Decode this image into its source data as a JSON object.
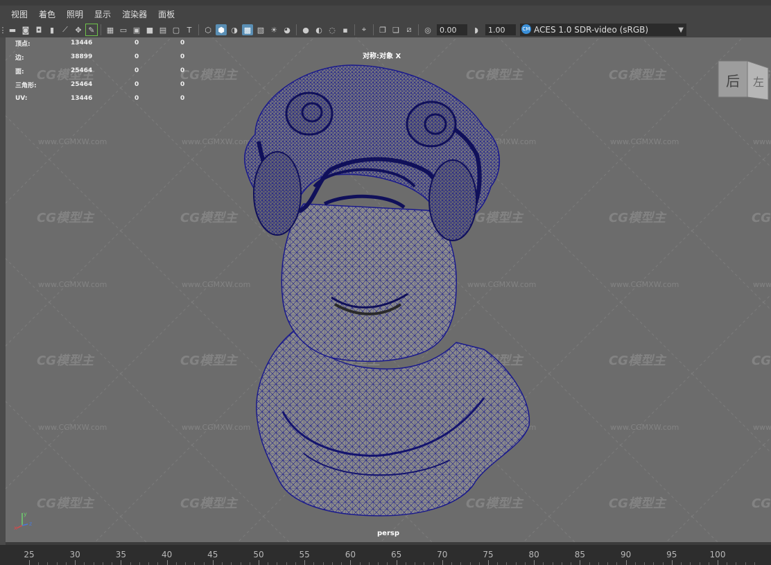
{
  "menu": [
    "视图",
    "着色",
    "照明",
    "显示",
    "渲染器",
    "面板"
  ],
  "toolbar": {
    "field1": "0.00",
    "field2": "1.00",
    "color_management": "ACES 1.0 SDR-video (sRGB)",
    "cm_icon_label": "CM",
    "dropdown_arrow": "▼"
  },
  "stats": [
    {
      "label": "顶点:",
      "v1": "13446",
      "v2": "0",
      "v3": "0"
    },
    {
      "label": "边:",
      "v1": "38899",
      "v2": "0",
      "v3": "0"
    },
    {
      "label": "面:",
      "v1": "25464",
      "v2": "0",
      "v3": "0"
    },
    {
      "label": "三角形:",
      "v1": "25464",
      "v2": "0",
      "v3": "0"
    },
    {
      "label": "UV:",
      "v1": "13446",
      "v2": "0",
      "v3": "0"
    }
  ],
  "symmetry": "对称:对象 X",
  "camera": "persp",
  "viewcube_label": "后",
  "viewcube_side": "左",
  "watermark": {
    "brand": "CG模型主",
    "url": "www.CGMXW.com"
  },
  "axis": {
    "x": "x",
    "y": "y",
    "z": "z"
  },
  "timeline": [
    "25",
    "30",
    "35",
    "40",
    "45",
    "50",
    "55",
    "60",
    "65",
    "70",
    "75",
    "80",
    "85",
    "90",
    "95",
    "100"
  ],
  "colors": {
    "wire": "#1a1a8c",
    "viewport_bg": "#6c6c6c",
    "accent": "#5a8fb5"
  }
}
